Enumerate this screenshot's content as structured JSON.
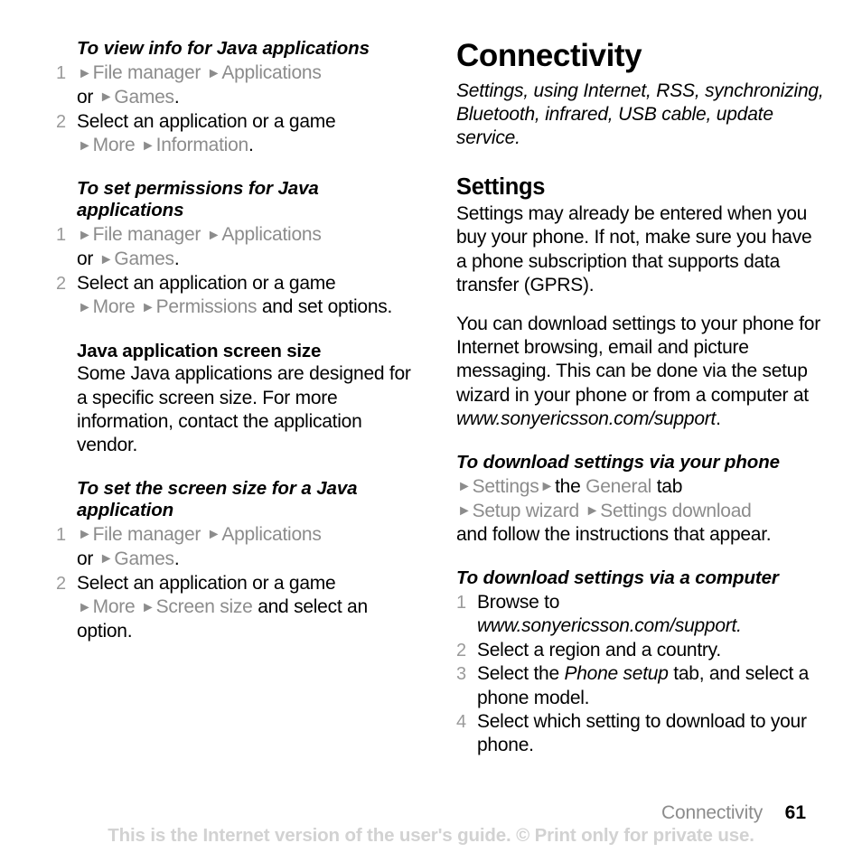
{
  "left_column": {
    "blocks": [
      {
        "kind": "proc-title",
        "text": "To view info for Java applications"
      },
      {
        "kind": "steps",
        "items": [
          {
            "num": "1",
            "line1_a": "File manager",
            "line1_b": "Applications",
            "line2_pre": "or",
            "line2_menu": "Games",
            "line2_post": "."
          },
          {
            "num": "2",
            "lead": "Select an application or a game",
            "sub_a": "More",
            "sub_b": "Information",
            "sub_post": "."
          }
        ]
      },
      {
        "kind": "proc-title",
        "text": "To set permissions for Java applications"
      },
      {
        "kind": "steps",
        "items": [
          {
            "num": "1",
            "line1_a": "File manager",
            "line1_b": "Applications",
            "line2_pre": "or",
            "line2_menu": "Games",
            "line2_post": "."
          },
          {
            "num": "2",
            "lead": "Select an application or a game",
            "sub_a": "More",
            "sub_b": "Permissions",
            "sub_post": " and set options."
          }
        ]
      },
      {
        "kind": "sub-head",
        "text": "Java application screen size"
      },
      {
        "kind": "body",
        "text": "Some Java applications are designed for a specific screen size. For more information, contact the application vendor."
      },
      {
        "kind": "proc-title",
        "text": "To set the screen size for a Java application"
      },
      {
        "kind": "steps",
        "items": [
          {
            "num": "1",
            "line1_a": "File manager",
            "line1_b": "Applications",
            "line2_pre": "or",
            "line2_menu": "Games",
            "line2_post": "."
          },
          {
            "num": "2",
            "lead": "Select an application or a game",
            "sub_a": "More",
            "sub_b": "Screen size",
            "sub_post": " and select an option."
          }
        ]
      }
    ]
  },
  "right_column": {
    "chapter_title": "Connectivity",
    "chapter_subtitle": "Settings, using Internet, RSS, synchronizing, Bluetooth, infrared, USB cable, update service.",
    "section_heading": "Settings",
    "paragraph_1": "Settings may already be entered when you buy your phone. If not, make sure you have a phone subscription that supports data transfer (GPRS).",
    "paragraph_2_pre": "You can download settings to your phone for Internet browsing, email and picture messaging. This can be done via the setup wizard in your phone or from a computer at ",
    "paragraph_2_url": "www.sonyericsson.com/support",
    "paragraph_2_post": ".",
    "proc_phone": {
      "title": "To download settings via your phone",
      "menu_1": "Settings",
      "mid_the": "the",
      "menu_2": "General",
      "after_tab": "tab",
      "menu_3": "Setup wizard",
      "menu_4": "Settings download",
      "tail": "and follow the instructions that appear."
    },
    "proc_computer": {
      "title": "To download settings via a computer",
      "steps": [
        {
          "num": "1",
          "pre": "Browse to ",
          "ital": "www.sonyericsson.com/support",
          "post": "."
        },
        {
          "num": "2",
          "pre": "Select a region and a country.",
          "ital": "",
          "post": ""
        },
        {
          "num": "3",
          "pre": "Select the ",
          "ital": "Phone setup",
          "post": " tab, and select a phone model."
        },
        {
          "num": "4",
          "pre": "Select which setting to download to your phone.",
          "ital": "",
          "post": ""
        }
      ]
    }
  },
  "footer": {
    "running_head": "Connectivity",
    "page_number": "61",
    "disclaimer": "This is the Internet version of the user's guide. © Print only for private use."
  },
  "icons": {
    "menu_arrow": "►"
  },
  "colors": {
    "menu_gray": "#8c8c8c",
    "number_gray": "#9a9a9a",
    "disclaimer_gray": "#d2d2d2",
    "text_black": "#000000"
  }
}
